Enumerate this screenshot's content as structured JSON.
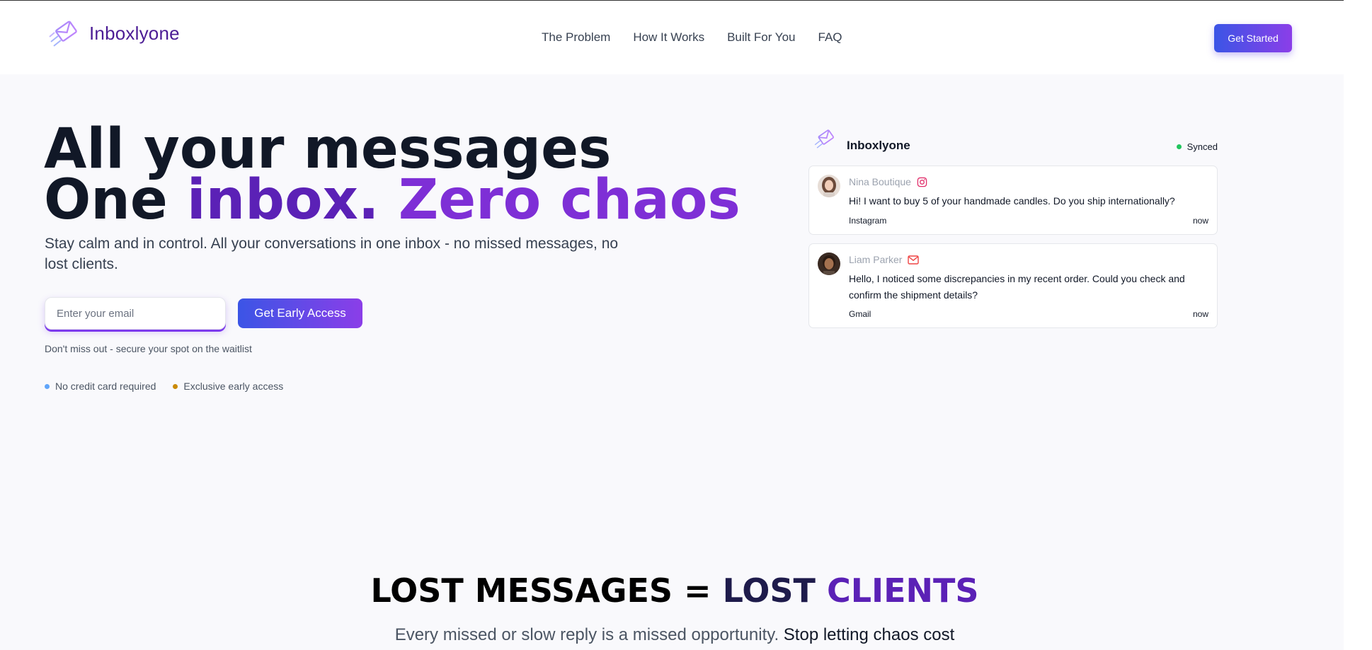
{
  "header": {
    "logo_text": "Inboxlyone",
    "nav": [
      "The Problem",
      "How It Works",
      "Built For You",
      "FAQ"
    ],
    "cta_label": "Get Started"
  },
  "hero": {
    "headline_line1": "All your messages",
    "headline_line2_a": "One ",
    "headline_line2_b": "inbox.",
    "headline_line2_c": " Zero chaos",
    "subtitle": "Stay calm and in control. All your conversations in one inbox - no missed messages, no lost clients.",
    "email_placeholder": "Enter your email",
    "early_access_label": "Get Early Access",
    "waitlist_note": "Don't miss out - secure your spot on the waitlist",
    "perks": [
      "No credit card required",
      "Exclusive early access"
    ],
    "perk_colors": [
      "#60a5fa",
      "#ca8a04"
    ]
  },
  "preview": {
    "title": "Inboxlyone",
    "status": "Synced",
    "status_color": "#22c55e",
    "messages": [
      {
        "sender": "Nina Boutique",
        "channel_icon": "instagram-icon",
        "body": "Hi! I want to buy 5 of your handmade candles. Do you ship internationally?",
        "source": "Instagram",
        "time": "now"
      },
      {
        "sender": "Liam Parker",
        "channel_icon": "mail-icon",
        "body": "Hello, I noticed some discrepancies in my recent order. Could you check and confirm the shipment details?",
        "source": "Gmail",
        "time": "now"
      }
    ]
  },
  "problem": {
    "title_a": "LOST MESSAGES = ",
    "title_b": "LOST ",
    "title_c": "CLIENTS",
    "subtitle_a": "Every missed or slow reply is a missed opportunity. ",
    "subtitle_b": "Stop letting chaos cost"
  },
  "colors": {
    "accent_start": "#3b55e6",
    "accent_end": "#8b3ee8",
    "brand_purple": "#4c1d95"
  }
}
